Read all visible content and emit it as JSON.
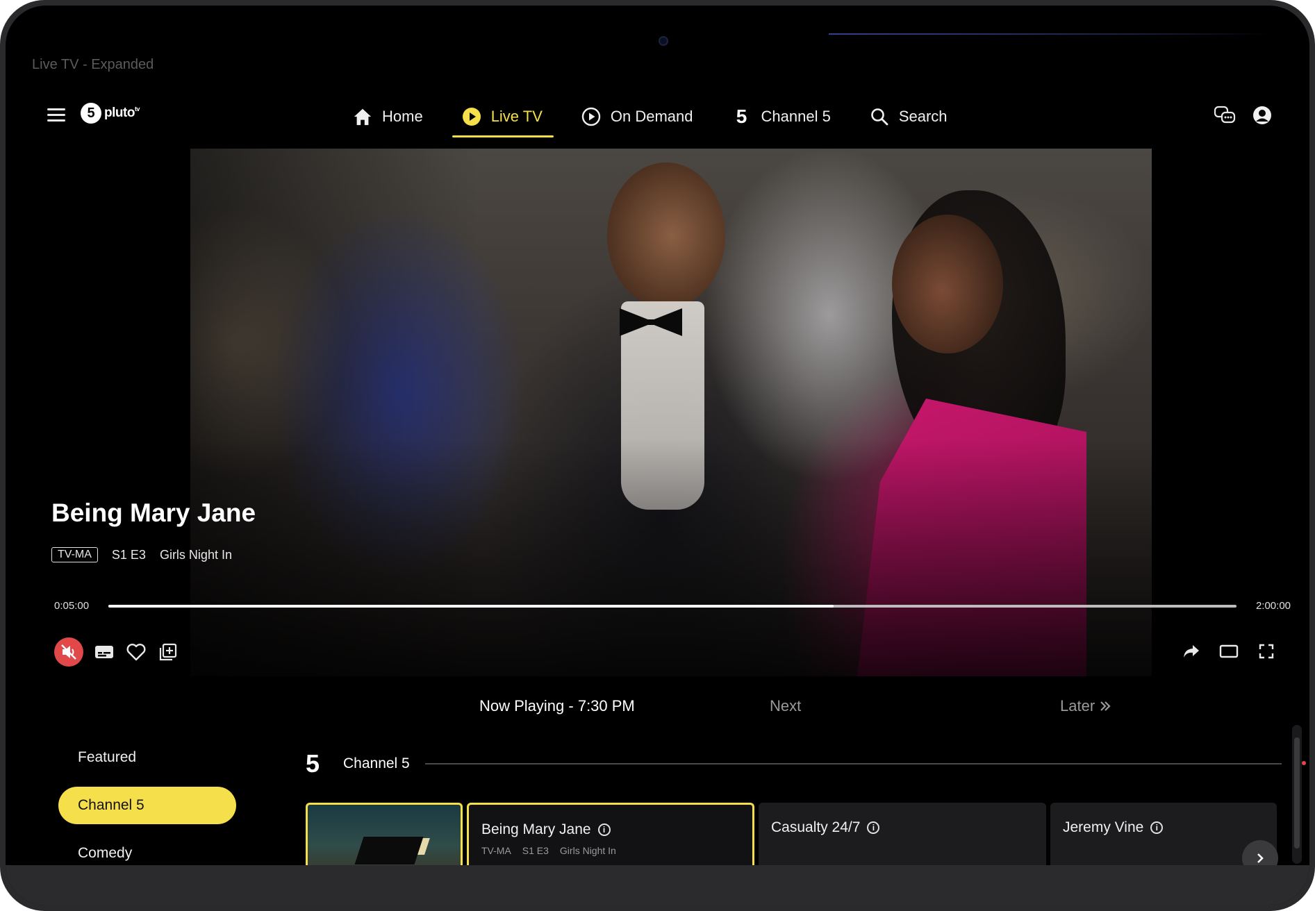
{
  "window": {
    "title": "Live TV - Expanded"
  },
  "brand": {
    "logo_mark": "5",
    "logo_text": "pluto",
    "logo_tv": "tv"
  },
  "nav": {
    "items": [
      {
        "label": "Home",
        "icon": "home-icon",
        "active": false
      },
      {
        "label": "Live TV",
        "icon": "play-circle-icon",
        "active": true
      },
      {
        "label": "On Demand",
        "icon": "play-outline-icon",
        "active": false
      },
      {
        "label": "Channel 5",
        "icon": "channel5-icon",
        "active": false
      },
      {
        "label": "Search",
        "icon": "search-icon",
        "active": false
      }
    ]
  },
  "top_right": {
    "icons": [
      "language-icon",
      "account-icon"
    ]
  },
  "player": {
    "show_title": "Being Mary Jane",
    "rating": "TV-MA",
    "episode": "S1 E3",
    "episode_title": "Girls Night In",
    "time_elapsed": "0:05:00",
    "time_total": "2:00:00",
    "progress_fraction": 0.643,
    "left_controls": [
      "mute-icon",
      "subtitles-icon",
      "heart-icon",
      "add-to-list-icon"
    ],
    "right_controls": [
      "share-icon",
      "theater-mode-icon",
      "fullscreen-icon"
    ],
    "accent": "#e0484a"
  },
  "guide": {
    "now_playing": "Now Playing - 7:30 PM",
    "next": "Next",
    "later": "Later",
    "categories": [
      {
        "label": "Featured",
        "active": false
      },
      {
        "label": "Channel 5",
        "active": true
      },
      {
        "label": "Comedy",
        "active": false
      }
    ],
    "channel": {
      "logo": "5",
      "name": "Channel 5",
      "programs": [
        {
          "title": "Being Mary Jane",
          "rating": "TV-MA",
          "episode": "S1 E3",
          "episode_title": "Girls Night In",
          "current": true
        },
        {
          "title": "Casualty 24/7",
          "current": false
        },
        {
          "title": "Jeremy Vine",
          "current": false
        }
      ]
    }
  },
  "colors": {
    "accent_yellow": "#f5e04b",
    "background": "#000000"
  }
}
